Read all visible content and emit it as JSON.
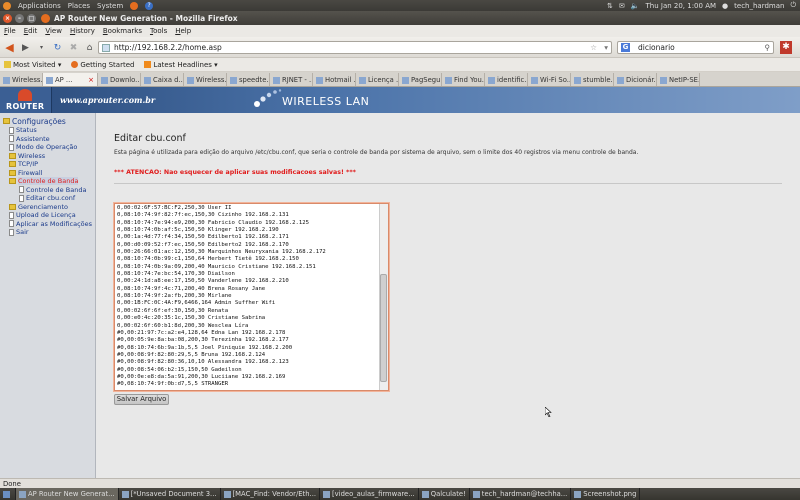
{
  "top_panel": {
    "menus": [
      "Applications",
      "Places",
      "System"
    ],
    "clock": "Thu Jan 20,  1:00 AM",
    "user": "tech_hardman"
  },
  "window": {
    "title": "AP Router New Generation - Mozilla Firefox"
  },
  "menubar": [
    "File",
    "Edit",
    "View",
    "History",
    "Bookmarks",
    "Tools",
    "Help"
  ],
  "navbar": {
    "url": "http://192.168.2.2/home.asp",
    "search_value": "dicionario",
    "search_engine_icon": "G"
  },
  "bookmarks": [
    "Most Visited ▾",
    "Getting Started",
    "Latest Headlines ▾"
  ],
  "tabs": [
    {
      "label": "Wireless...",
      "active": false
    },
    {
      "label": "AP ...",
      "active": true
    },
    {
      "label": "Downlo...",
      "active": false
    },
    {
      "label": "Caixa d...",
      "active": false
    },
    {
      "label": "Wireless...",
      "active": false
    },
    {
      "label": "speedte...",
      "active": false
    },
    {
      "label": "RJNET - ...",
      "active": false
    },
    {
      "label": "Hotmail ...",
      "active": false
    },
    {
      "label": "Licença ...",
      "active": false
    },
    {
      "label": "PagSegu...",
      "active": false
    },
    {
      "label": "Find You...",
      "active": false
    },
    {
      "label": "identific...",
      "active": false
    },
    {
      "label": "Wi-Fi So...",
      "active": false
    },
    {
      "label": "stumble...",
      "active": false
    },
    {
      "label": "Dicionár...",
      "active": false
    },
    {
      "label": "NetIP-SE...",
      "active": false
    }
  ],
  "banner": {
    "logo_text": "ROUTER",
    "site": "www.aprouter.com.br",
    "title": "WIRELESS LAN"
  },
  "sidebar": {
    "root": "Configurações",
    "items": [
      {
        "label": "Status",
        "level": 1,
        "type": "doc",
        "selected": false
      },
      {
        "label": "Assistente",
        "level": 1,
        "type": "doc",
        "selected": false
      },
      {
        "label": "Modo de Operação",
        "level": 1,
        "type": "doc",
        "selected": false
      },
      {
        "label": "Wireless",
        "level": 1,
        "type": "folder",
        "selected": false
      },
      {
        "label": "TCP/IP",
        "level": 1,
        "type": "folder",
        "selected": false
      },
      {
        "label": "Firewall",
        "level": 1,
        "type": "folder",
        "selected": false
      },
      {
        "label": "Controle de Banda",
        "level": 1,
        "type": "folder",
        "selected": true
      },
      {
        "label": "Controle de Banda",
        "level": 2,
        "type": "doc",
        "selected": false
      },
      {
        "label": "Editar cbu.conf",
        "level": 2,
        "type": "doc",
        "selected": false
      },
      {
        "label": "Gerenciamento",
        "level": 1,
        "type": "folder",
        "selected": false
      },
      {
        "label": "Upload de Licença",
        "level": 1,
        "type": "doc",
        "selected": false
      },
      {
        "label": "Aplicar as Modificações",
        "level": 1,
        "type": "doc",
        "selected": false
      },
      {
        "label": "Sair",
        "level": 1,
        "type": "doc",
        "selected": false
      }
    ]
  },
  "main": {
    "title": "Editar cbu.conf",
    "description": "Esta página é utilizada para edição do arquivo /etc/cbu.conf, que seria o controle de banda por sistema de arquivo, sem o limite dos 40 registros via menu controle de banda.",
    "warning": "*** ATENCAO: Nao esquecer de aplicar suas modificacoes salvas! ***",
    "conf_lines": [
      "0,00:02:6F:57:BC:F2,250,30 User II",
      "0,08:10:74:9f:82:7f:ec,150,30 Cizinho 192.168.2.131",
      "0,08:10:74:7e:94:e9,200,30 Fabricio Claudio 192.168.2.125",
      "0,08:10:74:0b:af:5c,150,50 Klinger 192.168.2.190",
      "0,00:1a:4d:77:f4:34,150,50 Edilberto1 192.168.2.171",
      "0,00:d0:09:52:f7:ec,150,50 Edilberto2 192.168.2.170",
      "0,00:26:66:01:ac:12,150,30 Marquinhos Neuryxania 192.168.2.172",
      "0,08:10:74:0b:99:c1,150,64 Herbert Tietê 192.168.2.150",
      "0,08:10:74:0b:9a:09,200,40 Mauricio Cristiane 192.168.2.151",
      "0,08:10:74:7e:bc:54,170,30 Diailson",
      "0,00:24:1d:a8:ee:17,150,50 Vanderlene 192.168.2.210",
      "0,08:10:74:9f:4c:71,200,40 Brena Rosany Jane",
      "0,08:10:74:9f:2a:fb,200,30 Mirlane",
      "0,00:1B:FC:0C:4A:F9,6466,164 Admin Suffher Wifi",
      "0,00:02:6f:6f:ef:30,150,30 Renata",
      "0,00:e0:4c:20:35:1c,150,30 Cristiane Sabrina",
      "0,00:02:6f:60:b1:8d,200,30 Wesclea Líra",
      "#0,00:21:97:7c:a2:e4,128,64 Edna Lan 192.168.2.178",
      "#0,00:05:9e:8a:ba:08,200,30 Terezinha 192.168.2.177",
      "#0,08:10:74:6b:9a:1b,5,5 Joel Piniquie 192.168.2.200",
      "#0,00:08:9f:82:80:29,5,5 Bruna 192.168.2.124",
      "#0,00:08:9f:82:80:36,10,10 Alessandra 192.168.2.123",
      "#0,00:08:54:06:b2:15,150,50 Gadeilson",
      "#0,00:0e:e8:da:5a:91,200,30 Luciiane 192.168.2.169",
      "#0,08:10:74:9f:0b:d7,5,5 STRANGER",
      "#0,00:26:66:01:ab:fc,0,0 stranger II"
    ],
    "save_label": "Salvar Arquivo"
  },
  "status": "Done",
  "taskbar": [
    {
      "label": "AP Router New Generat...",
      "active": true
    },
    {
      "label": "[*Unsaved Document 3...",
      "active": false
    },
    {
      "label": "[MAC_Find: Vendor/Eth...",
      "active": false
    },
    {
      "label": "[video_aulas_firmware...",
      "active": false
    },
    {
      "label": "Qalculate!",
      "active": false
    },
    {
      "label": "tech_hardman@techha...",
      "active": false
    },
    {
      "label": "Screenshot.png",
      "active": false
    }
  ],
  "colors": {
    "warning": "#e01b1b",
    "sidebar_selected": "#d22222",
    "banner": "#2a4a7a"
  }
}
